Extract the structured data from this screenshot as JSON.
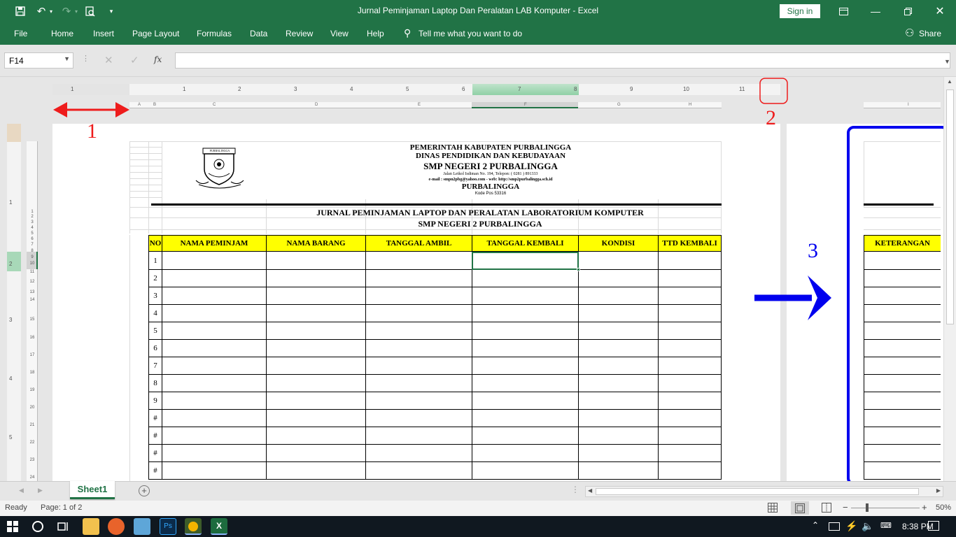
{
  "window": {
    "title": "Jurnal Peminjaman Laptop Dan Peralatan LAB Komputer  -  Excel",
    "sign_in": "Sign in"
  },
  "ribbon": {
    "tabs": [
      "File",
      "Home",
      "Insert",
      "Page Layout",
      "Formulas",
      "Data",
      "Review",
      "View",
      "Help"
    ],
    "tell_me": "Tell me what you want to do",
    "share": "Share"
  },
  "formula_bar": {
    "name_box": "F14",
    "cancel": "✕",
    "enter": "✓",
    "fx": "fx",
    "formula": ""
  },
  "ruler": {
    "numbers": [
      "1",
      "1",
      "2",
      "3",
      "4",
      "5",
      "6",
      "7",
      "8",
      "9",
      "10",
      "11"
    ],
    "columns": [
      "A",
      "B",
      "C",
      "D",
      "E",
      "F",
      "G",
      "H"
    ],
    "page2_column": "I",
    "row_numbers": [
      "1",
      "2",
      "3",
      "4",
      "5",
      "6",
      "7",
      "8",
      "9",
      "10",
      "11",
      "12",
      "13",
      "14",
      "15",
      "16",
      "17",
      "18",
      "19",
      "20",
      "21",
      "22",
      "23",
      "24",
      "25",
      "26"
    ],
    "vertical_ruler": [
      "1",
      "2",
      "3",
      "4",
      "5"
    ]
  },
  "sheet": {
    "header": {
      "line1": "PEMERINTAH KABUPATEN PURBALINGGA",
      "line2": "DINAS PENDIDIKAN DAN KEBUDAYAAN",
      "line3": "SMP NEGERI 2 PURBALINGGA",
      "address": "Jalan  Letkol Isdiman No. 194, Telepon: ( 0281 ) 891333",
      "contact": "e-mail : smpn2pbg@yahoo.com  -  web: http://smp2purbalingga.sch.id",
      "city": "PURBALINGGA",
      "postal": "Kode Pos 53316",
      "logo_text": "PURBALINGGA"
    },
    "title1": "JURNAL PEMINJAMAN LAPTOP DAN PERALATAN LABORATORIUM KOMPUTER",
    "title2": "SMP NEGERI 2 PURBALINGGA",
    "columns": [
      "NO",
      "NAMA PEMINJAM",
      "NAMA BARANG",
      "TANGGAL AMBIL",
      "TANGGAL KEMBALI",
      "KONDISI",
      "TTD KEMBALI"
    ],
    "page2_column": "KETERANGAN",
    "row_numbers": [
      "1",
      "2",
      "3",
      "4",
      "5",
      "6",
      "7",
      "8",
      "9",
      "#",
      "#",
      "#",
      "#"
    ]
  },
  "annotations": {
    "label1": "1",
    "label2": "2",
    "label3": "3",
    "color_red": "#ee1c1c",
    "color_blue": "#0000ee"
  },
  "sheet_tabs": {
    "active": "Sheet1",
    "add": "+"
  },
  "status_bar": {
    "ready": "Ready",
    "page": "Page: 1 of 2",
    "zoom": "50%"
  },
  "taskbar": {
    "time": "8:38 PM"
  },
  "colors": {
    "excel_green": "#217346",
    "header_yellow": "#ffff00"
  }
}
